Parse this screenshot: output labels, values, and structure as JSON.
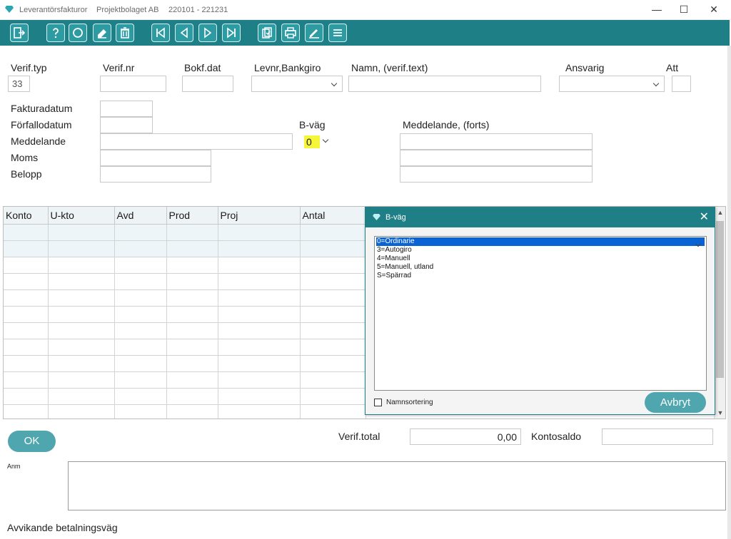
{
  "window": {
    "app_title": "Leverantörsfakturor",
    "company": "Projektbolaget AB",
    "period": "220101 - 221231",
    "controls": {
      "minimize": "—",
      "maximize": "☐",
      "close": "✕"
    }
  },
  "toolbar": {
    "buttons": [
      "exit-icon",
      "help-icon",
      "search-icon",
      "eraser-icon",
      "trash-icon",
      "first-icon",
      "prev-icon",
      "next-icon",
      "last-icon",
      "copy-icon",
      "print-icon",
      "edit-icon",
      "menu-icon"
    ]
  },
  "form": {
    "verif_typ_label": "Verif.typ",
    "verif_typ_value": "33",
    "verif_nr_label": "Verif.nr",
    "bokf_dat_label": "Bokf.dat",
    "levnr_label": "Levnr,Bankgiro",
    "namn_label": "Namn, (verif.text)",
    "ansvarig_label": "Ansvarig",
    "att_label": "Att",
    "fakturadatum_label": "Fakturadatum",
    "forfallodatum_label": "Förfallodatum",
    "meddelande_label": "Meddelande",
    "moms_label": "Moms",
    "belopp_label": "Belopp",
    "bvag_label": "B-väg",
    "bvag_value": "0",
    "meddelande_forts_label": "Meddelande, (forts)"
  },
  "grid": {
    "columns": [
      "Konto",
      "U-kto",
      "Avd",
      "Prod",
      "Proj",
      "Antal"
    ]
  },
  "dialog": {
    "title": "B-väg",
    "close": "✕",
    "options": [
      "0=Ordinarie",
      "3=Autogiro",
      "4=Manuell",
      "5=Manuell, utland",
      "S=Spärrad"
    ],
    "selected_index": 0,
    "checkbox_label": "Namnsortering",
    "cancel_label": "Avbryt"
  },
  "footer": {
    "ok_label": "OK",
    "verif_total_label": "Verif.total",
    "verif_total_value": "0,00",
    "kontosaldo_label": "Kontosaldo",
    "anm_label": "Anm",
    "status_text": "Avvikande betalningsväg"
  },
  "colors": {
    "accent": "#1f7f86",
    "highlight": "#f5f53a",
    "selection": "#0a63d4"
  }
}
